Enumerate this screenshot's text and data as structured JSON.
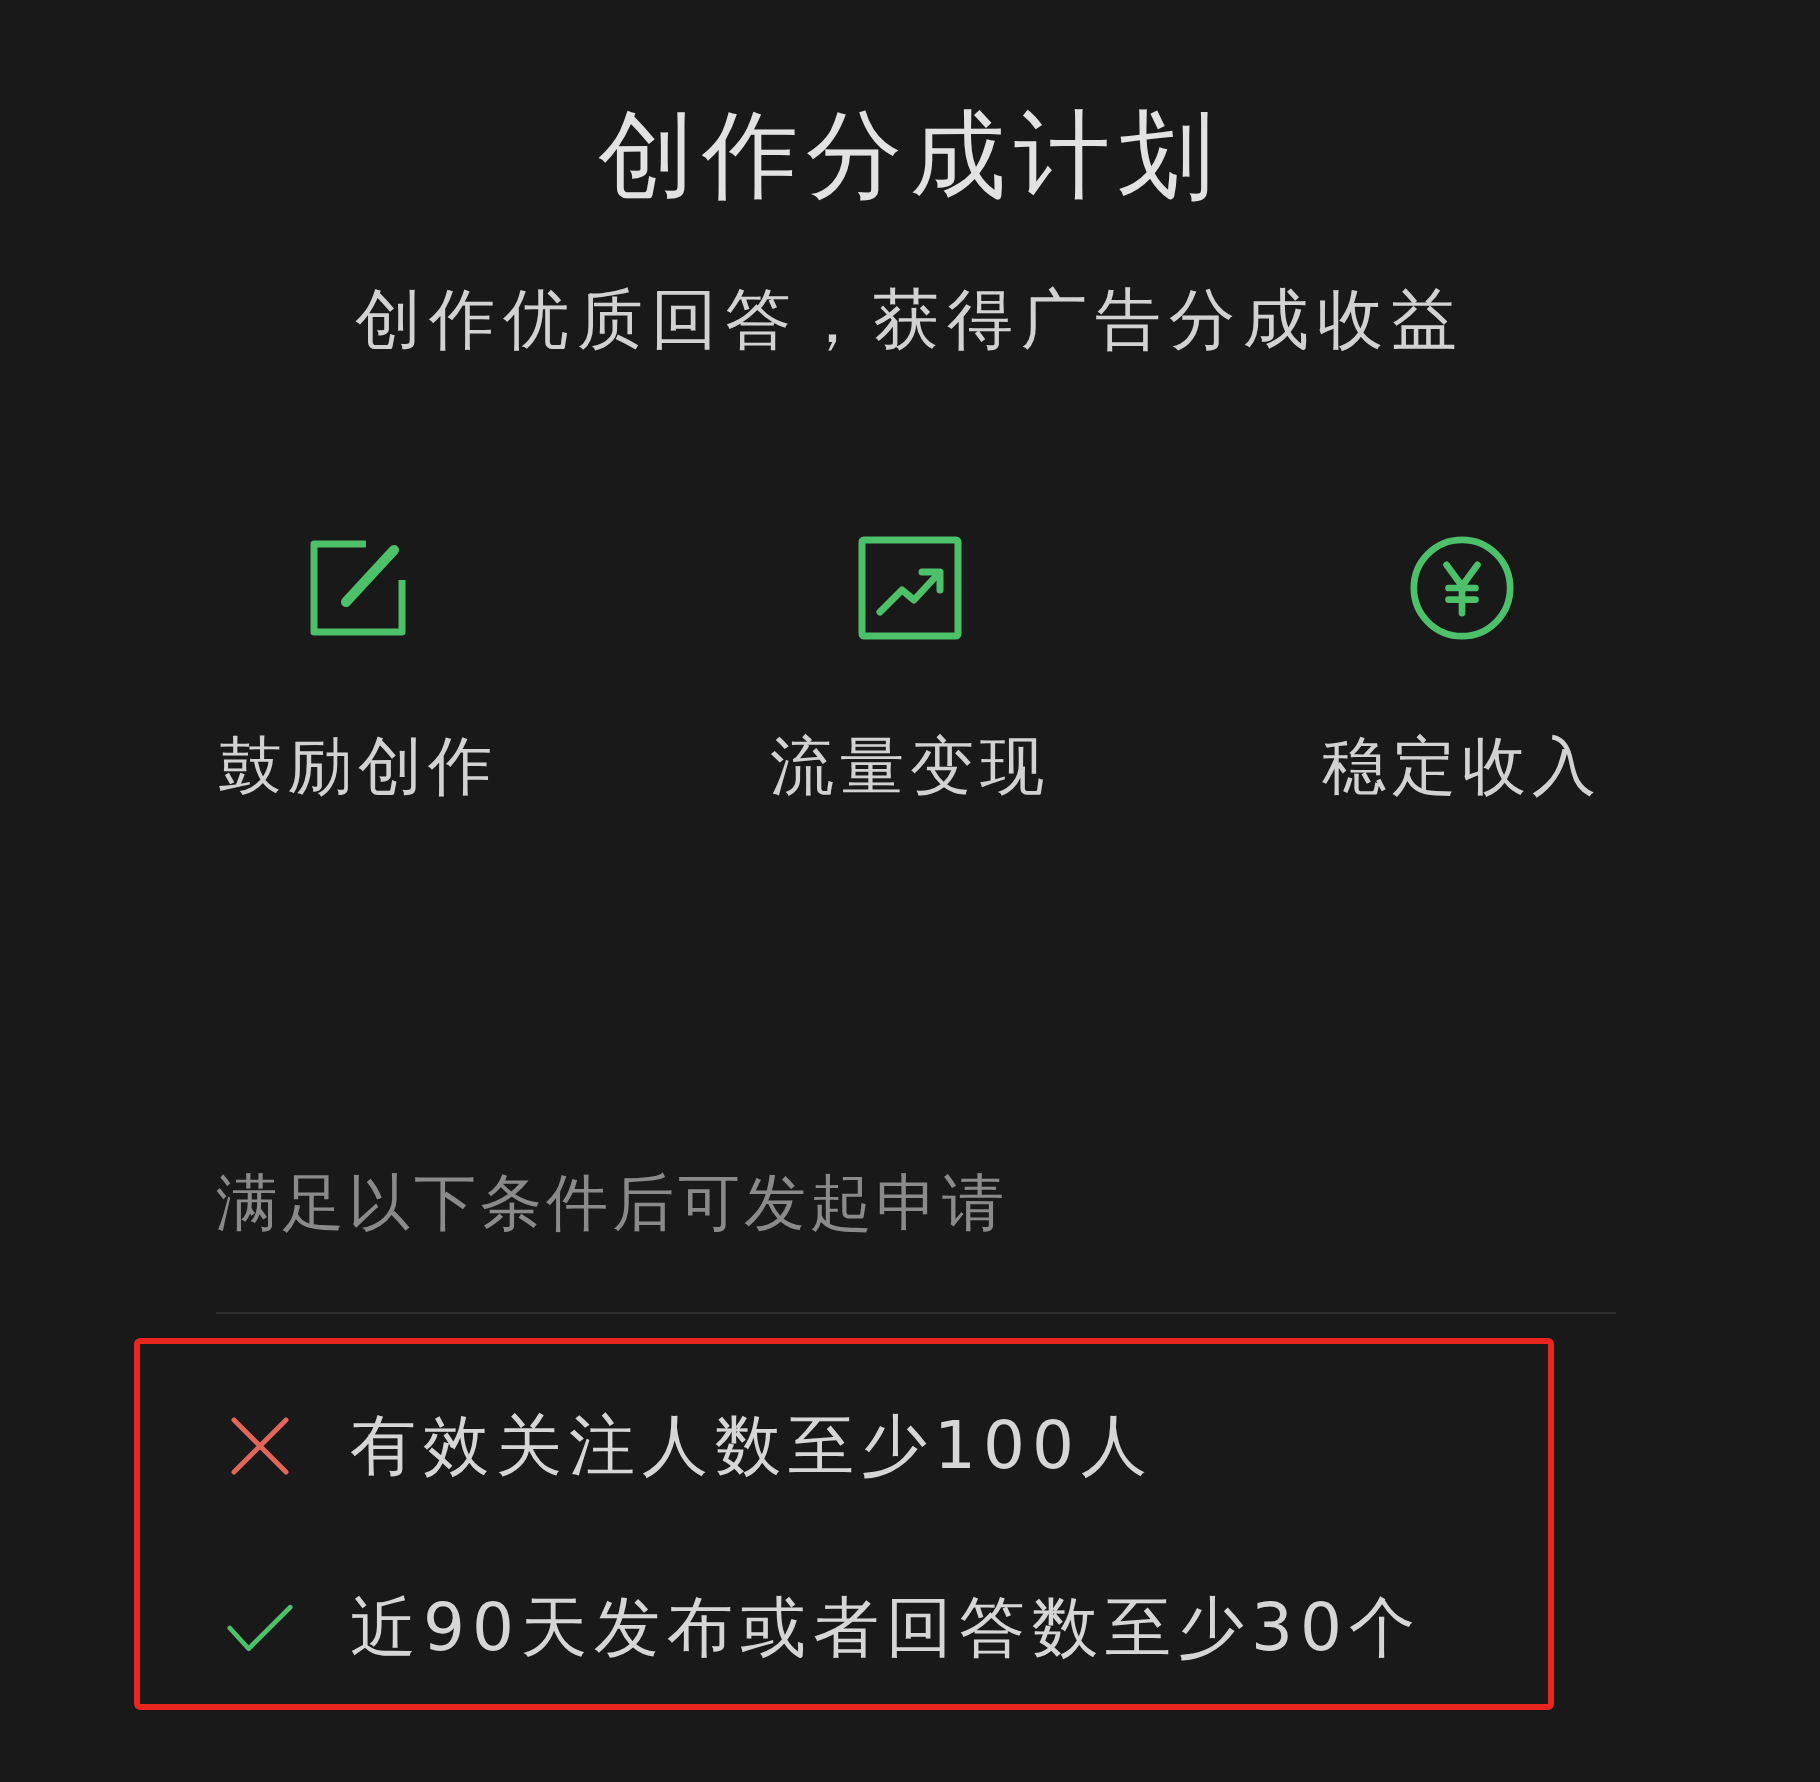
{
  "header": {
    "title": "创作分成计划",
    "subtitle": "创作优质回答，获得广告分成收益"
  },
  "features": [
    {
      "kind": "edit",
      "label": "鼓励创作"
    },
    {
      "kind": "chart",
      "label": "流量变现"
    },
    {
      "kind": "yen",
      "label": "稳定收入"
    }
  ],
  "requirements": {
    "heading": "满足以下条件后可发起申请",
    "items": [
      {
        "text": "有效关注人数至少100人",
        "met": false
      },
      {
        "text": "近90天发布或者回答数至少30个",
        "met": true
      }
    ]
  }
}
